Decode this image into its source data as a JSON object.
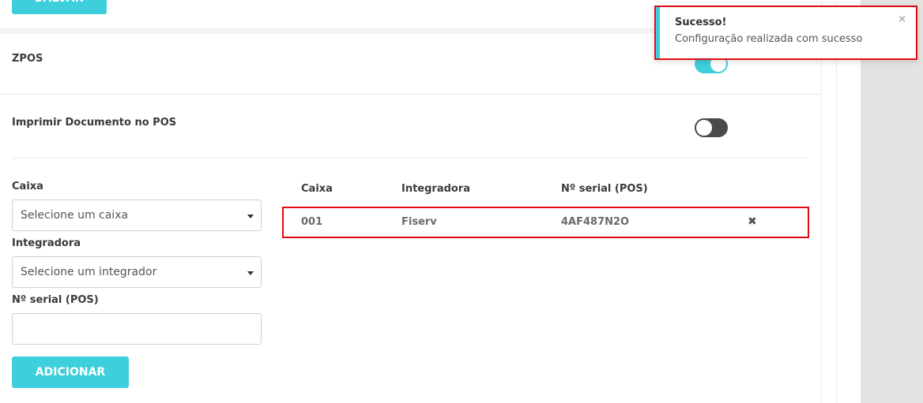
{
  "toolbar": {
    "save_label": "SALVAR"
  },
  "settings": {
    "zpos": {
      "label": "ZPOS",
      "enabled": true
    },
    "imprimir": {
      "label": "Imprimir Documento no POS",
      "enabled": false
    }
  },
  "form": {
    "caixa": {
      "label": "Caixa",
      "placeholder": "Selecione um caixa"
    },
    "integradora": {
      "label": "Integradora",
      "placeholder": "Selecione um integrador"
    },
    "serial": {
      "label": "Nº serial (POS)",
      "value": ""
    },
    "add_label": "ADICIONAR"
  },
  "table": {
    "headers": [
      "Caixa",
      "Integradora",
      "Nº serial (POS)"
    ],
    "rows": [
      {
        "caixa": "001",
        "integradora": "Fiserv",
        "serial": "4AF487N2O",
        "delete_icon": "close-icon"
      }
    ]
  },
  "toast": {
    "title": "Sucesso!",
    "message": "Configuração realizada com sucesso",
    "close_icon": "close-icon",
    "accent_color": "#3ecfdc"
  },
  "colors": {
    "accent": "#3ecfdc",
    "highlight": "#e00b12",
    "toggle_off": "#4a4a4a"
  }
}
